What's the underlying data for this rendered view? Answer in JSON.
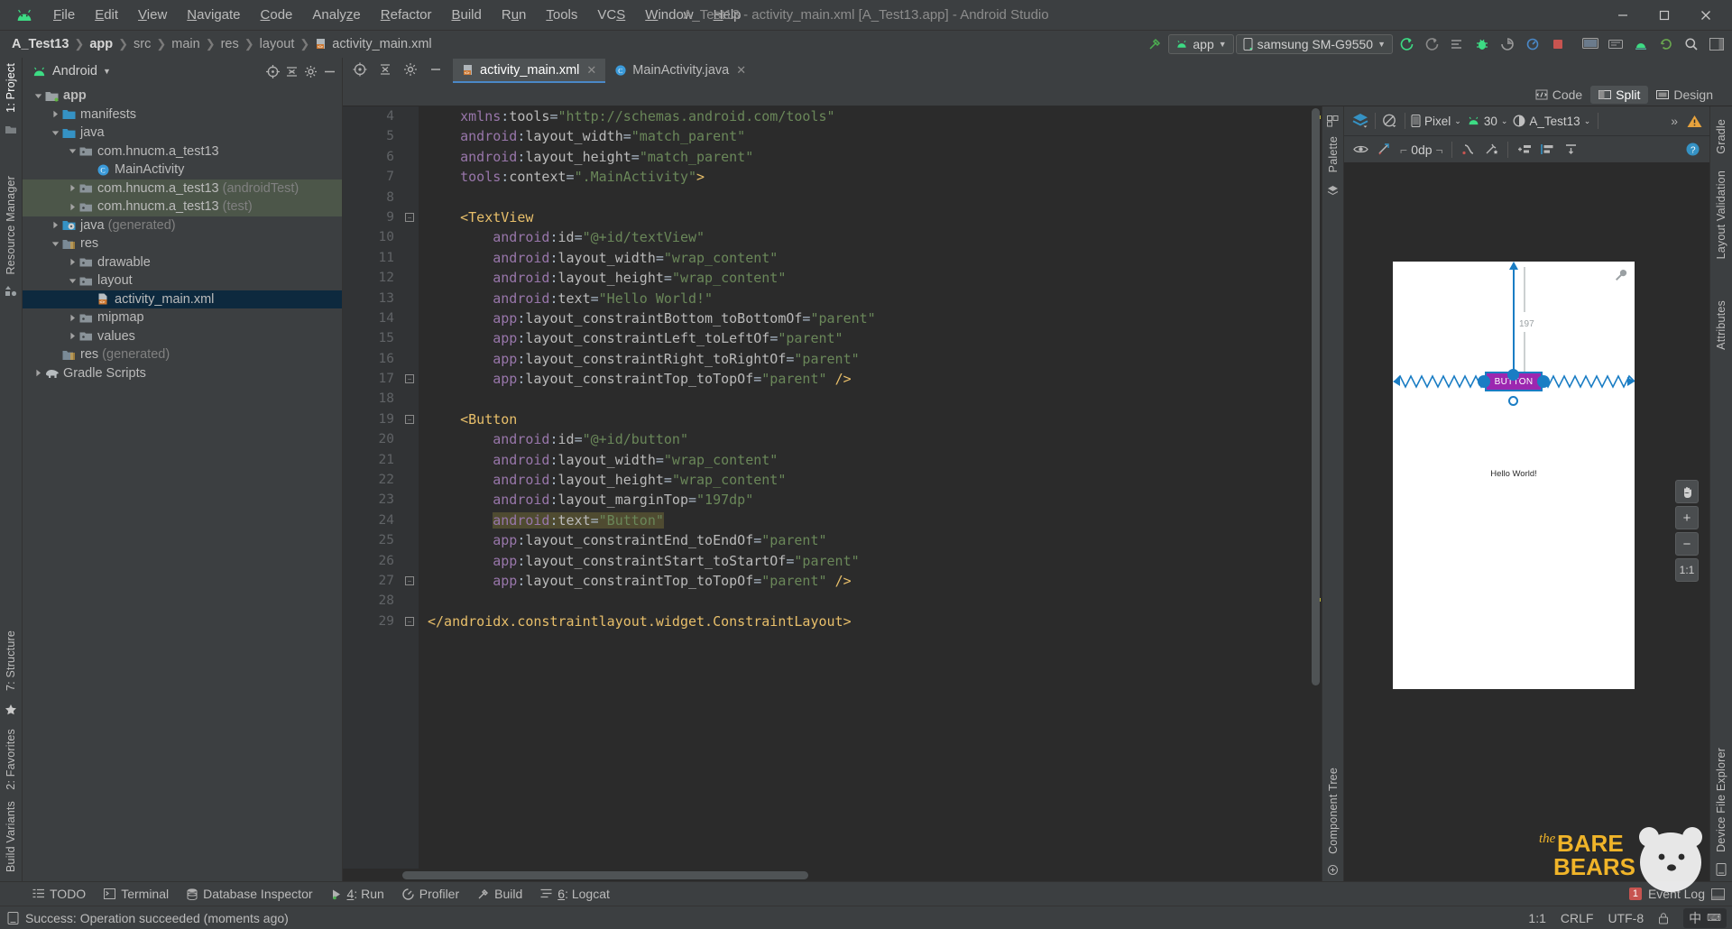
{
  "window": {
    "title": "A_Test13 - activity_main.xml [A_Test13.app] - Android Studio",
    "minimize": "—",
    "maximize": "▢",
    "close": "✕"
  },
  "menubar": {
    "logo_icon": "android-logo-icon",
    "items": [
      {
        "label": "File",
        "mnemonic": "F"
      },
      {
        "label": "Edit",
        "mnemonic": "E"
      },
      {
        "label": "View",
        "mnemonic": "V"
      },
      {
        "label": "Navigate",
        "mnemonic": "N"
      },
      {
        "label": "Code",
        "mnemonic": "C"
      },
      {
        "label": "Analyze",
        "mnemonic": "z"
      },
      {
        "label": "Refactor",
        "mnemonic": "R"
      },
      {
        "label": "Build",
        "mnemonic": "B"
      },
      {
        "label": "Run",
        "mnemonic": "n"
      },
      {
        "label": "Tools",
        "mnemonic": "T"
      },
      {
        "label": "VCS",
        "mnemonic": "S"
      },
      {
        "label": "Window",
        "mnemonic": "W"
      },
      {
        "label": "Help",
        "mnemonic": "H"
      }
    ]
  },
  "navbar": {
    "breadcrumbs": [
      "A_Test13",
      "app",
      "src",
      "main",
      "res",
      "layout",
      "activity_main.xml"
    ],
    "run_config": "app",
    "device": "samsung SM-G9550",
    "icons": [
      "make-project-icon",
      "run-icon",
      "debug-icon",
      "rerun-icon",
      "apply-changes-icon",
      "stop-icon",
      "avd-manager-icon",
      "sdk-manager-icon",
      "search-icon"
    ]
  },
  "project_panel": {
    "view_label": "Android",
    "view_icon": "android-logo-icon",
    "header_actions": [
      "select-opened-file-icon",
      "collapse-all-icon",
      "settings-gear-icon",
      "hide-icon"
    ],
    "tree": [
      {
        "label": "app",
        "depth": 0,
        "arrow": "down",
        "icon": "module-folder-icon",
        "bold": true
      },
      {
        "label": "manifests",
        "depth": 1,
        "arrow": "right",
        "icon": "folder-blue-icon"
      },
      {
        "label": "java",
        "depth": 1,
        "arrow": "down",
        "icon": "folder-blue-icon"
      },
      {
        "label": "com.hnucm.a_test13",
        "depth": 2,
        "arrow": "down",
        "icon": "package-icon"
      },
      {
        "label": "MainActivity",
        "depth": 3,
        "arrow": "none",
        "icon": "class-icon"
      },
      {
        "label": "com.hnucm.a_test13",
        "suffix": " (androidTest)",
        "depth": 2,
        "arrow": "right",
        "icon": "package-icon",
        "highlight": "green"
      },
      {
        "label": "com.hnucm.a_test13",
        "suffix": " (test)",
        "depth": 2,
        "arrow": "right",
        "icon": "package-icon",
        "highlight": "green"
      },
      {
        "label": "java",
        "suffix": " (generated)",
        "depth": 1,
        "arrow": "right",
        "icon": "folder-generated-icon"
      },
      {
        "label": "res",
        "depth": 1,
        "arrow": "down",
        "icon": "folder-res-icon"
      },
      {
        "label": "drawable",
        "depth": 2,
        "arrow": "right",
        "icon": "package-icon"
      },
      {
        "label": "layout",
        "depth": 2,
        "arrow": "down",
        "icon": "package-icon"
      },
      {
        "label": "activity_main.xml",
        "depth": 3,
        "arrow": "none",
        "icon": "xml-layout-icon",
        "selected": true
      },
      {
        "label": "mipmap",
        "depth": 2,
        "arrow": "right",
        "icon": "package-icon"
      },
      {
        "label": "values",
        "depth": 2,
        "arrow": "right",
        "icon": "package-icon"
      },
      {
        "label": "res",
        "suffix": " (generated)",
        "depth": 1,
        "arrow": "none",
        "icon": "folder-res-icon"
      },
      {
        "label": "Gradle Scripts",
        "depth": 0,
        "arrow": "right",
        "icon": "gradle-elephant-icon"
      }
    ]
  },
  "left_rail": {
    "top": [
      {
        "label": "1: Project",
        "active": true
      }
    ],
    "bottom": [
      {
        "label": "Build Variants"
      },
      {
        "label": "2: Favorites"
      },
      {
        "label": "7: Structure"
      },
      {
        "label": "Resource Manager"
      }
    ]
  },
  "right_rail": {
    "items": [
      {
        "label": "Gradle"
      },
      {
        "label": "Layout Validation"
      },
      {
        "label": "Device File Explorer"
      }
    ]
  },
  "editor": {
    "tabs": [
      {
        "label": "activity_main.xml",
        "icon": "xml-layout-icon",
        "active": true,
        "closable": true
      },
      {
        "label": "MainActivity.java",
        "icon": "java-class-icon",
        "active": false,
        "closable": true
      }
    ],
    "modes": [
      {
        "label": "Code",
        "icon": "code-mode-icon",
        "active": false
      },
      {
        "label": "Split",
        "icon": "split-mode-icon",
        "active": true
      },
      {
        "label": "Design",
        "icon": "design-mode-icon",
        "active": false
      }
    ],
    "first_line_number": 4,
    "lines": [
      {
        "n": 4,
        "indent": 4,
        "tokens": [
          {
            "t": "xmlns",
            "c": "ns"
          },
          {
            "t": ":",
            "c": "eq"
          },
          {
            "t": "tools",
            "c": "attr"
          },
          {
            "t": "=",
            "c": "eq"
          },
          {
            "t": "\"http://schemas.android.com/tools\"",
            "c": "str"
          }
        ]
      },
      {
        "n": 5,
        "indent": 4,
        "tokens": [
          {
            "t": "android",
            "c": "ns"
          },
          {
            "t": ":",
            "c": "eq"
          },
          {
            "t": "layout_width",
            "c": "attr"
          },
          {
            "t": "=",
            "c": "eq"
          },
          {
            "t": "\"match_parent\"",
            "c": "str"
          }
        ]
      },
      {
        "n": 6,
        "indent": 4,
        "tokens": [
          {
            "t": "android",
            "c": "ns"
          },
          {
            "t": ":",
            "c": "eq"
          },
          {
            "t": "layout_height",
            "c": "attr"
          },
          {
            "t": "=",
            "c": "eq"
          },
          {
            "t": "\"match_parent\"",
            "c": "str"
          }
        ]
      },
      {
        "n": 7,
        "indent": 4,
        "tokens": [
          {
            "t": "tools",
            "c": "ns"
          },
          {
            "t": ":",
            "c": "eq"
          },
          {
            "t": "context",
            "c": "attr"
          },
          {
            "t": "=",
            "c": "eq"
          },
          {
            "t": "\".MainActivity\"",
            "c": "str"
          },
          {
            "t": ">",
            "c": "punct"
          }
        ]
      },
      {
        "n": 8,
        "indent": 0,
        "tokens": []
      },
      {
        "n": 9,
        "indent": 4,
        "fold": true,
        "tokens": [
          {
            "t": "<TextView",
            "c": "tag"
          }
        ]
      },
      {
        "n": 10,
        "indent": 8,
        "tokens": [
          {
            "t": "android",
            "c": "ns"
          },
          {
            "t": ":",
            "c": "eq"
          },
          {
            "t": "id",
            "c": "attr"
          },
          {
            "t": "=",
            "c": "eq"
          },
          {
            "t": "\"@+id/textView\"",
            "c": "str"
          }
        ]
      },
      {
        "n": 11,
        "indent": 8,
        "tokens": [
          {
            "t": "android",
            "c": "ns"
          },
          {
            "t": ":",
            "c": "eq"
          },
          {
            "t": "layout_width",
            "c": "attr"
          },
          {
            "t": "=",
            "c": "eq"
          },
          {
            "t": "\"wrap_content\"",
            "c": "str"
          }
        ]
      },
      {
        "n": 12,
        "indent": 8,
        "tokens": [
          {
            "t": "android",
            "c": "ns"
          },
          {
            "t": ":",
            "c": "eq"
          },
          {
            "t": "layout_height",
            "c": "attr"
          },
          {
            "t": "=",
            "c": "eq"
          },
          {
            "t": "\"wrap_content\"",
            "c": "str"
          }
        ]
      },
      {
        "n": 13,
        "indent": 8,
        "tokens": [
          {
            "t": "android",
            "c": "ns"
          },
          {
            "t": ":",
            "c": "eq"
          },
          {
            "t": "text",
            "c": "attr"
          },
          {
            "t": "=",
            "c": "eq"
          },
          {
            "t": "\"Hello World!\"",
            "c": "str"
          }
        ]
      },
      {
        "n": 14,
        "indent": 8,
        "tokens": [
          {
            "t": "app",
            "c": "ns"
          },
          {
            "t": ":",
            "c": "eq"
          },
          {
            "t": "layout_constraintBottom_toBottomOf",
            "c": "attr"
          },
          {
            "t": "=",
            "c": "eq"
          },
          {
            "t": "\"parent\"",
            "c": "str"
          }
        ]
      },
      {
        "n": 15,
        "indent": 8,
        "tokens": [
          {
            "t": "app",
            "c": "ns"
          },
          {
            "t": ":",
            "c": "eq"
          },
          {
            "t": "layout_constraintLeft_toLeftOf",
            "c": "attr"
          },
          {
            "t": "=",
            "c": "eq"
          },
          {
            "t": "\"parent\"",
            "c": "str"
          }
        ]
      },
      {
        "n": 16,
        "indent": 8,
        "tokens": [
          {
            "t": "app",
            "c": "ns"
          },
          {
            "t": ":",
            "c": "eq"
          },
          {
            "t": "layout_constraintRight_toRightOf",
            "c": "attr"
          },
          {
            "t": "=",
            "c": "eq"
          },
          {
            "t": "\"parent\"",
            "c": "str"
          }
        ]
      },
      {
        "n": 17,
        "indent": 8,
        "fold": true,
        "tokens": [
          {
            "t": "app",
            "c": "ns"
          },
          {
            "t": ":",
            "c": "eq"
          },
          {
            "t": "layout_constraintTop_toTopOf",
            "c": "attr"
          },
          {
            "t": "=",
            "c": "eq"
          },
          {
            "t": "\"parent\" ",
            "c": "str"
          },
          {
            "t": "/>",
            "c": "punct"
          }
        ]
      },
      {
        "n": 18,
        "indent": 0,
        "tokens": []
      },
      {
        "n": 19,
        "indent": 4,
        "fold": true,
        "tokens": [
          {
            "t": "<Button",
            "c": "tag"
          }
        ]
      },
      {
        "n": 20,
        "indent": 8,
        "tokens": [
          {
            "t": "android",
            "c": "ns"
          },
          {
            "t": ":",
            "c": "eq"
          },
          {
            "t": "id",
            "c": "attr"
          },
          {
            "t": "=",
            "c": "eq"
          },
          {
            "t": "\"@+id/button\"",
            "c": "str"
          }
        ]
      },
      {
        "n": 21,
        "indent": 8,
        "tokens": [
          {
            "t": "android",
            "c": "ns"
          },
          {
            "t": ":",
            "c": "eq"
          },
          {
            "t": "layout_width",
            "c": "attr"
          },
          {
            "t": "=",
            "c": "eq"
          },
          {
            "t": "\"wrap_content\"",
            "c": "str"
          }
        ]
      },
      {
        "n": 22,
        "indent": 8,
        "tokens": [
          {
            "t": "android",
            "c": "ns"
          },
          {
            "t": ":",
            "c": "eq"
          },
          {
            "t": "layout_height",
            "c": "attr"
          },
          {
            "t": "=",
            "c": "eq"
          },
          {
            "t": "\"wrap_content\"",
            "c": "str"
          }
        ]
      },
      {
        "n": 23,
        "indent": 8,
        "tokens": [
          {
            "t": "android",
            "c": "ns"
          },
          {
            "t": ":",
            "c": "eq"
          },
          {
            "t": "layout_marginTop",
            "c": "attr"
          },
          {
            "t": "=",
            "c": "eq"
          },
          {
            "t": "\"197dp\"",
            "c": "str"
          }
        ]
      },
      {
        "n": 24,
        "indent": 8,
        "highlight": true,
        "tokens": [
          {
            "t": "android",
            "c": "ns"
          },
          {
            "t": ":",
            "c": "eq"
          },
          {
            "t": "text",
            "c": "attr"
          },
          {
            "t": "=",
            "c": "eq"
          },
          {
            "t": "\"Button\"",
            "c": "str"
          }
        ]
      },
      {
        "n": 25,
        "indent": 8,
        "tokens": [
          {
            "t": "app",
            "c": "ns"
          },
          {
            "t": ":",
            "c": "eq"
          },
          {
            "t": "layout_constraintEnd_toEndOf",
            "c": "attr"
          },
          {
            "t": "=",
            "c": "eq"
          },
          {
            "t": "\"parent\"",
            "c": "str"
          }
        ]
      },
      {
        "n": 26,
        "indent": 8,
        "tokens": [
          {
            "t": "app",
            "c": "ns"
          },
          {
            "t": ":",
            "c": "eq"
          },
          {
            "t": "layout_constraintStart_toStartOf",
            "c": "attr"
          },
          {
            "t": "=",
            "c": "eq"
          },
          {
            "t": "\"parent\"",
            "c": "str"
          }
        ]
      },
      {
        "n": 27,
        "indent": 8,
        "fold": true,
        "tokens": [
          {
            "t": "app",
            "c": "ns"
          },
          {
            "t": ":",
            "c": "eq"
          },
          {
            "t": "layout_constraintTop_toTopOf",
            "c": "attr"
          },
          {
            "t": "=",
            "c": "eq"
          },
          {
            "t": "\"parent\" ",
            "c": "str"
          },
          {
            "t": "/>",
            "c": "punct"
          }
        ]
      },
      {
        "n": 28,
        "indent": 0,
        "tokens": []
      },
      {
        "n": 29,
        "indent": 0,
        "fold": true,
        "tokens": [
          {
            "t": "</androidx.constraintlayout.widget.ConstraintLayout>",
            "c": "tag"
          }
        ]
      }
    ]
  },
  "preview": {
    "palette_label": "Palette",
    "component_tree_label": "Component Tree",
    "attributes_label": "Attributes",
    "toolbar": {
      "layers_icon": "design-surface-layers-icon",
      "orientation_icon": "rotate-orientation-icon",
      "device_icon": "device-phone-icon",
      "device": "Pixel",
      "api_icon": "android-logo-icon",
      "api_level": "30",
      "theme_icon": "theme-contrast-icon",
      "theme": "A_Test13",
      "overflow": "»",
      "warning_icon": "warning-triangle-icon"
    },
    "toolbar2": {
      "visibility_icon": "eye-icon",
      "constraints_icon": "clear-constraints-icon",
      "margin_value": "0dp",
      "chain_icon": "create-chain-icon",
      "infer_icon": "infer-constraints-icon",
      "align_icon": "align-icon",
      "pack_icon": "pack-icon",
      "guideline_icon": "guidelines-icon",
      "help_icon": "help-circle-icon"
    },
    "canvas": {
      "widget_label": "BUTTON",
      "margin_label": "197",
      "text_label": "Hello World!",
      "accent_color": "#1a7dc4",
      "selection_color": "#9c27b0",
      "zoom_controls": [
        "pan-hand-icon",
        "zoom-in-icon",
        "zoom-out-icon",
        "zoom-actual-icon"
      ],
      "zoom_actual": "1:1",
      "zoom_plus": "+",
      "zoom_minus": "−"
    }
  },
  "tool_windows": {
    "items": [
      {
        "label": "TODO",
        "icon": "todo-icon",
        "mnemonic": ""
      },
      {
        "label": "Terminal",
        "icon": "terminal-icon",
        "mnemonic": ""
      },
      {
        "label": "Database Inspector",
        "icon": "database-icon",
        "mnemonic": ""
      },
      {
        "label": "4: Run",
        "icon": "run-icon",
        "mnemonic": "4"
      },
      {
        "label": "Profiler",
        "icon": "profiler-icon",
        "mnemonic": ""
      },
      {
        "label": "Build",
        "icon": "build-hammer-icon",
        "mnemonic": ""
      },
      {
        "label": "6: Logcat",
        "icon": "logcat-icon",
        "mnemonic": "6"
      }
    ],
    "event_log": {
      "label": "Event Log",
      "icon": "event-log-icon",
      "count": "1"
    }
  },
  "status_bar": {
    "icon": "status-message-icon",
    "message": "Success: Operation succeeded (moments ago)",
    "caret": "1:1",
    "line_sep": "CRLF",
    "encoding": "UTF-8",
    "ime": "中",
    "lock_icon": "lock-icon"
  },
  "watermark": {
    "line1": "the",
    "line2": "BARE",
    "line3": "BEARS",
    "color": "#f0b429"
  }
}
